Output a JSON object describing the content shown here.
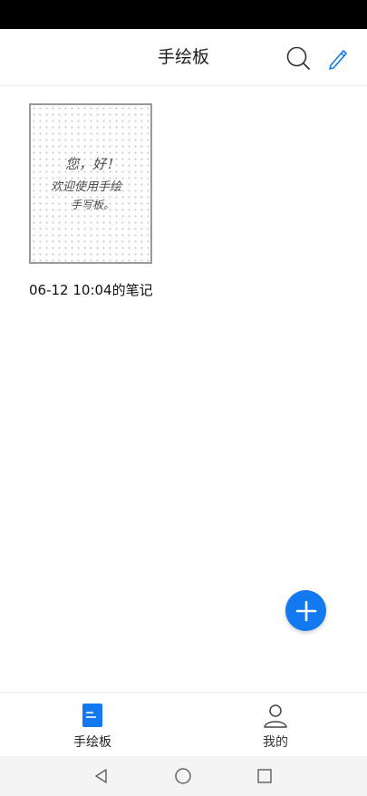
{
  "app_bar": {
    "title": "手绘板",
    "search_icon": "search-icon",
    "pen_icon": "pen-icon"
  },
  "notes": [
    {
      "caption": "06-12 10:04的笔记",
      "handwritten_text": [
        "您，好！",
        "欢迎使用手绘",
        "手写板。"
      ]
    }
  ],
  "fab": {
    "icon": "plus-icon",
    "color": "#1379f0"
  },
  "bottom_nav": {
    "items": [
      {
        "label": "手绘板",
        "icon": "note-doc-icon",
        "active": true,
        "color": "#1379f0"
      },
      {
        "label": "我的",
        "icon": "person-icon",
        "active": false
      }
    ]
  },
  "system_nav": {
    "back": "back-triangle-icon",
    "home": "home-circle-icon",
    "recent": "recent-square-icon"
  }
}
